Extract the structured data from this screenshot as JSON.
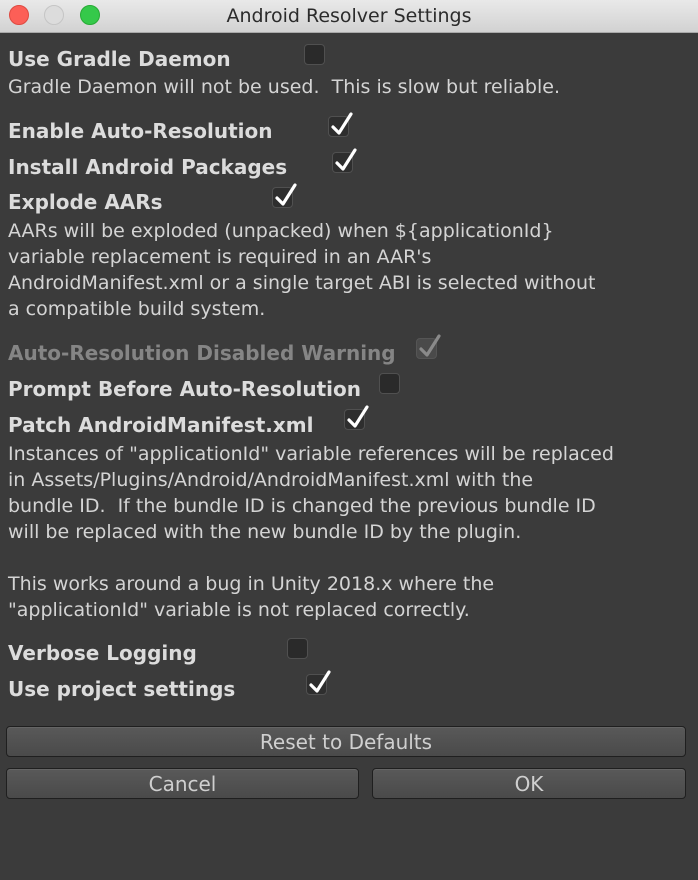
{
  "window": {
    "title": "Android Resolver Settings"
  },
  "settings": {
    "gradle_daemon": {
      "label": "Use Gradle Daemon",
      "checked": false,
      "desc": "Gradle Daemon will not be used.  This is slow but reliable."
    },
    "auto_resolution": {
      "label": "Enable Auto-Resolution",
      "checked": true
    },
    "install_packages": {
      "label": "Install Android Packages",
      "checked": true
    },
    "explode_aars": {
      "label": "Explode AARs",
      "checked": true,
      "desc": [
        "AARs will be exploded (unpacked) when ${applicationId}",
        "variable replacement is required in an AAR's",
        "AndroidManifest.xml or a single target ABI is selected without",
        "a compatible build system."
      ]
    },
    "auto_res_warning": {
      "label": "Auto-Resolution Disabled Warning",
      "checked": true,
      "disabled": true
    },
    "prompt_before": {
      "label": "Prompt Before Auto-Resolution",
      "checked": false
    },
    "patch_manifest": {
      "label": "Patch AndroidManifest.xml",
      "checked": true,
      "desc": [
        "Instances of \"applicationId\" variable references will be replaced",
        "in Assets/Plugins/Android/AndroidManifest.xml with the",
        "bundle ID.  If the bundle ID is changed the previous bundle ID",
        "will be replaced with the new bundle ID by the plugin.",
        "",
        "This works around a bug in Unity 2018.x where the",
        "\"applicationId\" variable is not replaced correctly."
      ]
    },
    "verbose_logging": {
      "label": "Verbose Logging",
      "checked": false
    },
    "project_settings": {
      "label": "Use project settings",
      "checked": true
    }
  },
  "buttons": {
    "reset": "Reset to Defaults",
    "cancel": "Cancel",
    "ok": "OK"
  }
}
